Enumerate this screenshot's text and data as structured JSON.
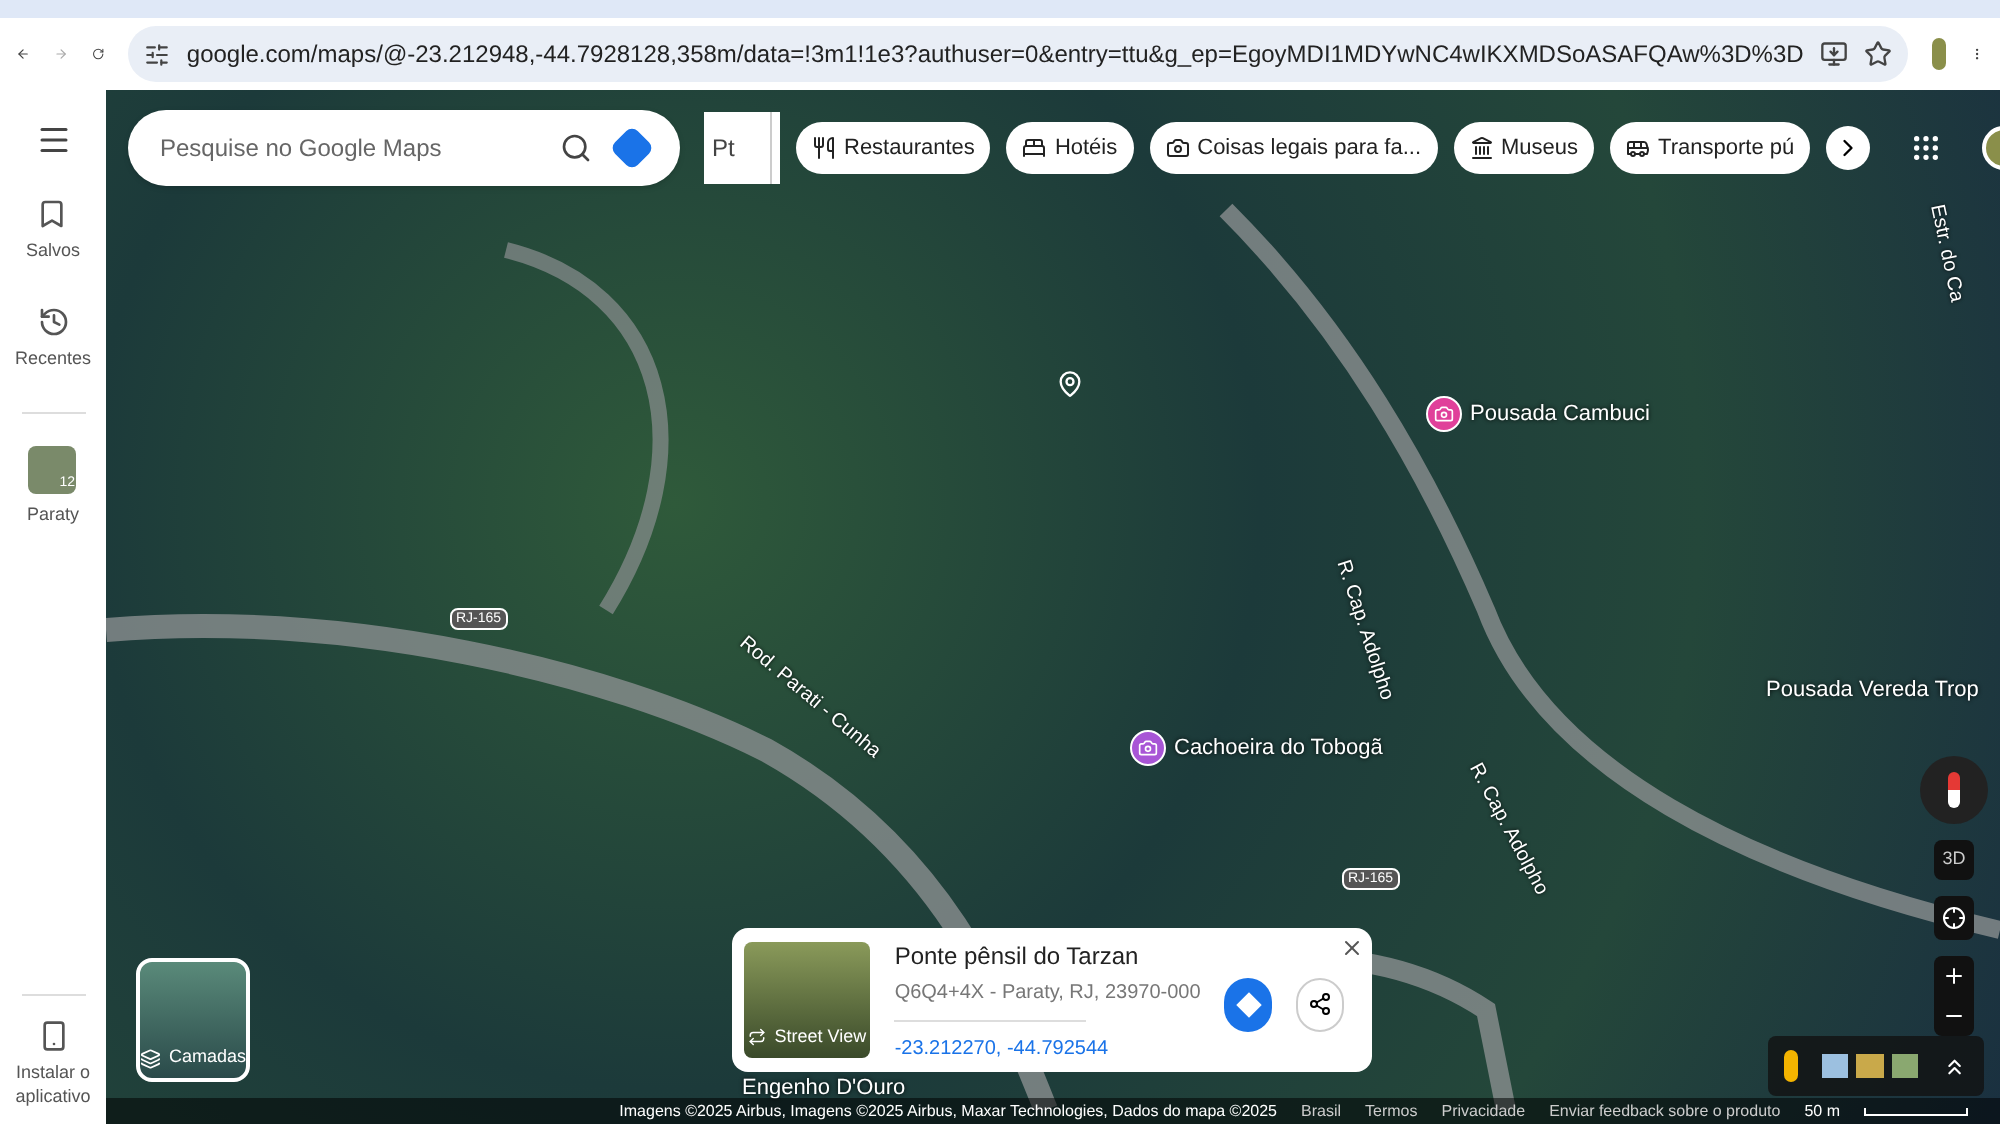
{
  "browser": {
    "url": "google.com/maps/@-23.212948,-44.7928128,358m/data=!3m1!1e3?authuser=0&entry=ttu&g_ep=EgoyMDI1MDYwNC4wIKXMDSoASAFQAw%3D%3D"
  },
  "sidebar": {
    "items": [
      {
        "kind": "saved",
        "label": "Salvos"
      },
      {
        "kind": "recent",
        "label": "Recentes"
      },
      {
        "kind": "photo",
        "label": "Paraty",
        "badge": "12"
      }
    ],
    "install": "Instalar o aplicativo"
  },
  "search": {
    "placeholder": "Pesquise no Google Maps"
  },
  "input_tool": "Pt",
  "chips": [
    {
      "kind": "food",
      "label": "Restaurantes"
    },
    {
      "kind": "bed",
      "label": "Hotéis"
    },
    {
      "kind": "camera",
      "label": "Coisas legais para fa..."
    },
    {
      "kind": "museum",
      "label": "Museus"
    },
    {
      "kind": "transit",
      "label": "Transporte pú"
    }
  ],
  "map_labels": [
    {
      "kind": "place",
      "label": "Pousada Cambuci",
      "color": "#e0409a"
    },
    {
      "kind": "place",
      "label": "Cachoeira do Tobogã",
      "color": "#a855d6"
    },
    {
      "kind": "text",
      "label": "Pousada Vereda Trop"
    },
    {
      "kind": "road",
      "label": "Rod. Parati - Cunha"
    },
    {
      "kind": "road",
      "label": "R. Cap. Adolpho"
    },
    {
      "kind": "road",
      "label": "R. Cap. Adolpho"
    },
    {
      "kind": "road",
      "label": "Estr. do Ca"
    },
    {
      "kind": "shield",
      "label": "RJ-165"
    },
    {
      "kind": "shield",
      "label": "RJ-165"
    },
    {
      "kind": "text",
      "label": "Engenho D'Ouro"
    }
  ],
  "layers": {
    "label": "Camadas"
  },
  "place_card": {
    "title": "Ponte pênsil do Tarzan",
    "address": "Q6Q4+4X - Paraty, RJ, 23970-000",
    "coords": "-23.212270, -44.792544",
    "street_view": "Street View"
  },
  "controls": {
    "tilt": "3D"
  },
  "footer": {
    "attribution": "Imagens ©2025 Airbus, Imagens ©2025 Airbus, Maxar Technologies, Dados do mapa ©2025",
    "links": [
      "Brasil",
      "Termos",
      "Privacidade",
      "Enviar feedback sobre o produto"
    ],
    "scale": "50 m"
  }
}
